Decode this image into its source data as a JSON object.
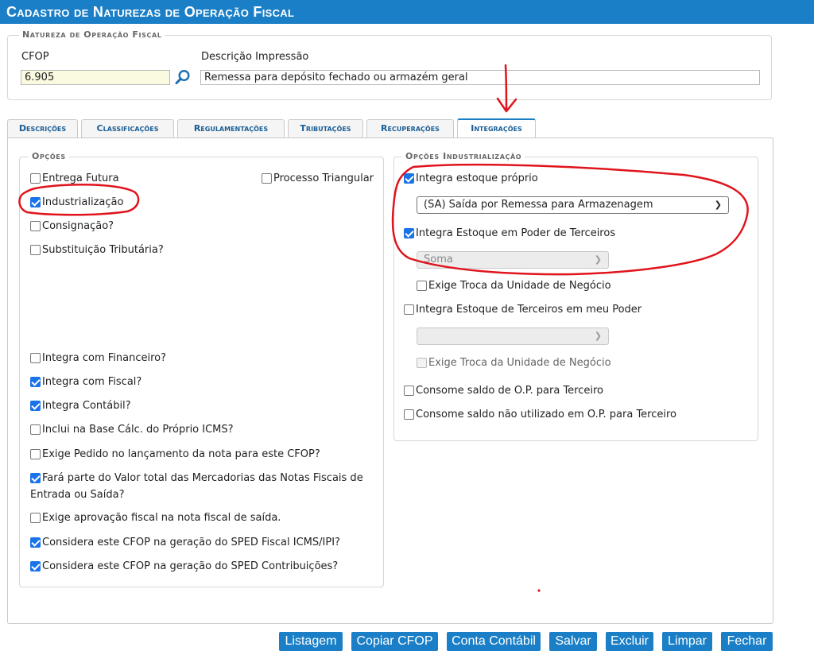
{
  "window": {
    "title": "Cadastro de Naturezas de Operação Fiscal"
  },
  "header_section": {
    "legend": "Natureza de Operação Fiscal",
    "cfop_label": "CFOP",
    "cfop_value": "6.905",
    "descricao_label": "Descrição Impressão",
    "descricao_value": "Remessa para depósito fechado ou armazém geral"
  },
  "tabs": [
    {
      "label": "Descrições",
      "active": false
    },
    {
      "label": "Classificações",
      "active": false
    },
    {
      "label": "Regulamentações",
      "active": false
    },
    {
      "label": "Tributações",
      "active": false
    },
    {
      "label": "Recuperações",
      "active": false
    },
    {
      "label": "Integrações",
      "active": true
    }
  ],
  "opcoes": {
    "legend": "Opções",
    "items": [
      {
        "label": "Entrega Futura",
        "checked": false
      },
      {
        "label": "Processo Triangular",
        "checked": false
      },
      {
        "label": "Industrialização",
        "checked": true
      },
      {
        "label": "Consignação?",
        "checked": false
      },
      {
        "label": "Substituição Tributária?",
        "checked": false
      },
      {
        "label": "Integra com Financeiro?",
        "checked": false
      },
      {
        "label": "Integra com Fiscal?",
        "checked": true
      },
      {
        "label": "Integra Contábil?",
        "checked": true
      },
      {
        "label": "Inclui na Base Cálc. do Próprio ICMS?",
        "checked": false
      },
      {
        "label": "Exige Pedido no lançamento da nota para este CFOP?",
        "checked": false
      },
      {
        "label": "Fará parte do Valor total das Mercadorias das Notas Fiscais de",
        "label_line2": "Entrada ou Saída?",
        "checked": true
      },
      {
        "label": "Exige aprovação fiscal na nota fiscal de saída.",
        "checked": false
      },
      {
        "label": "Considera este CFOP na geração do SPED Fiscal ICMS/IPI?",
        "checked": true
      },
      {
        "label": "Considera este CFOP na geração do SPED Contribuições?",
        "checked": true
      }
    ]
  },
  "industrializacao": {
    "legend": "Opções Industrialização",
    "integra_proprio": {
      "label": "Integra estoque próprio",
      "checked": true
    },
    "select_proprio": "(SA) Saída por Remessa para Armazenagem",
    "integra_terceiros": {
      "label": "Integra Estoque em Poder de Terceiros",
      "checked": true
    },
    "select_terceiros": "Soma",
    "exige_troca_1": {
      "label": "Exige Troca da Unidade de Negócio",
      "checked": false
    },
    "integra_meu_poder": {
      "label": "Integra Estoque de Terceiros em meu Poder",
      "checked": false
    },
    "select_meu_poder": "",
    "exige_troca_2": {
      "label": "Exige Troca da Unidade de Negócio",
      "checked": false
    },
    "consome_op": {
      "label": "Consome saldo de O.P. para Terceiro",
      "checked": false
    },
    "consome_nao_utilizado": {
      "label": "Consome saldo não utilizado em O.P. para Terceiro",
      "checked": false
    }
  },
  "buttons": [
    "Listagem",
    "Copiar CFOP",
    "Conta Contábil",
    "Salvar",
    "Excluir",
    "Limpar",
    "Fechar"
  ],
  "colors": {
    "accent": "#1a7fc6",
    "annotation": "#e0141c"
  },
  "icons": {
    "search": "magnifier-icon",
    "dropdown": "chevron-down-icon"
  }
}
